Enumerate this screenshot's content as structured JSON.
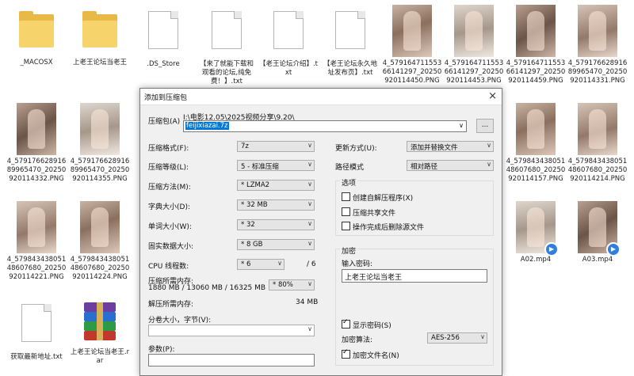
{
  "explorer": {
    "files": [
      {
        "name": "_MACOSX",
        "type": "folder"
      },
      {
        "name": "上老王论坛当老王",
        "type": "folder"
      },
      {
        "name": ".DS_Store",
        "type": "file"
      },
      {
        "name": "【来了就能下载和观看的论坛,纯免费！】.txt",
        "type": "txt"
      },
      {
        "name": "【老王论坛介绍】.txt",
        "type": "txt"
      },
      {
        "name": "【老王论坛永久地址发布页】.txt",
        "type": "txt"
      },
      {
        "name": "4_57916471155366141297_20250920114450.PNG",
        "type": "image"
      },
      {
        "name": "4_57916471155366141297_20250920114453.PNG",
        "type": "image"
      },
      {
        "name": "4_57916471155366141297_20250920114459.PNG",
        "type": "image"
      },
      {
        "name": "4_57917662891689965470_20250920114331.PNG",
        "type": "image"
      },
      {
        "name": "4_57917662891689965470_20250920114332.PNG",
        "type": "image"
      },
      {
        "name": "4_57917662891689965470_20250920114355.PNG",
        "type": "image"
      },
      {
        "name": "4_57984343805148607680_20250920114157.PNG",
        "type": "image"
      },
      {
        "name": "4_57984343805148607680_20250920114214.PNG",
        "type": "image"
      },
      {
        "name": "4_57984343805148607680_20250920114221.PNG",
        "type": "image"
      },
      {
        "name": "4_57984343805148607680_20250920114224.PNG",
        "type": "image"
      },
      {
        "name": "A02.mp4",
        "type": "video"
      },
      {
        "name": "A03.mp4",
        "type": "video"
      },
      {
        "name": "获取最新地址.txt",
        "type": "txt"
      },
      {
        "name": "上老王论坛当老王.rar",
        "type": "rar"
      }
    ]
  },
  "dialog": {
    "title": "添加到压缩包",
    "close": "×",
    "archive_label": "压缩包(A)",
    "archive_path": "I:\\电影12.05\\2025视频分享\\9.20\\",
    "archive_name": "feijixiazai.7z",
    "browse": "...",
    "format_label": "压缩格式(F):",
    "format_value": "7z",
    "level_label": "压缩等级(L):",
    "level_value": "5 - 标准压缩",
    "method_label": "压缩方法(M):",
    "method_value": "* LZMA2",
    "dict_label": "字典大小(D):",
    "dict_value": "* 32 MB",
    "word_label": "单词大小(W):",
    "word_value": "* 32",
    "solid_label": "固实数据大小:",
    "solid_value": "* 8 GB",
    "cpu_label": "CPU 线程数:",
    "cpu_value": "* 6",
    "cpu_total": "/ 6",
    "mem_label": "压缩所需内存:",
    "mem_detail": "1880 MB / 13060 MB / 16325 MB",
    "mem_percent": "* 80%",
    "decomp_label": "解压所需内存:",
    "decomp_value": "34 MB",
    "split_label": "分卷大小，字节(V):",
    "split_value": "",
    "params_label": "参数(P):",
    "params_value": "",
    "update_label": "更新方式(U):",
    "update_value": "添加并替换文件",
    "path_label": "路径模式",
    "path_value": "相对路径",
    "options_title": "选项",
    "opt_sfx": "创建自解压程序(X)",
    "opt_shared": "压缩共享文件",
    "opt_delete": "操作完成后删除源文件",
    "encrypt_title": "加密",
    "password_label": "输入密码:",
    "password_value": "上老王论坛当老王",
    "show_password": "显示密码(S)",
    "encrypt_method_label": "加密算法:",
    "encrypt_method_value": "AES-256",
    "encrypt_names": "加密文件名(N)"
  }
}
